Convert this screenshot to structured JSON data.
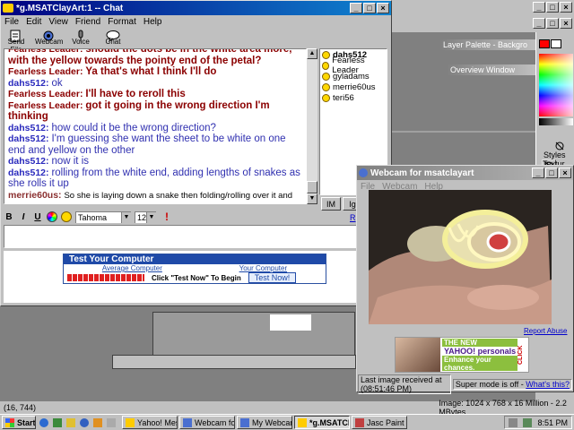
{
  "chat_window": {
    "title": "*g.MSATClayArt:1 -- Chat",
    "menu": [
      "File",
      "Edit",
      "View",
      "Friend",
      "Format",
      "Help"
    ],
    "toolbar": [
      {
        "label": "Send File",
        "icon": "send-file-icon"
      },
      {
        "label": "Webcam",
        "icon": "webcam-icon"
      },
      {
        "label": "Voice",
        "icon": "voice-icon"
      },
      {
        "label": "Chat",
        "icon": "chat-icon"
      }
    ],
    "messages": [
      {
        "sender": "Fearless Leader",
        "kind": "leader",
        "text": "should the dots be in the white area more, with the yellow towards the pointy end of the petal?"
      },
      {
        "sender": "Fearless Leader",
        "kind": "leader",
        "text": "Ya that's what I think I'll do"
      },
      {
        "sender": "dahs512",
        "kind": "dahs",
        "text": "ok"
      },
      {
        "sender": "Fearless Leader",
        "kind": "leader",
        "text": "I'll have to reroll this"
      },
      {
        "sender": "Fearless Leader",
        "kind": "leader",
        "text": "got it going in the wrong direction I'm thinking"
      },
      {
        "sender": "dahs512",
        "kind": "dahs",
        "text": "how could it be the wrong direction?"
      },
      {
        "sender": "dahs512",
        "kind": "dahs",
        "text": "I'm guessing she want the sheet to be white on one end and yellow on the other"
      },
      {
        "sender": "dahs512",
        "kind": "dahs",
        "text": "now it is"
      },
      {
        "sender": "dahs512",
        "kind": "dahs",
        "text": "rolling from the white end, adding lengths of snakes as she rolls it up"
      },
      {
        "sender": "merrie60us",
        "kind": "merrie",
        "text": "So she is laying down a snake then folding/rolling over it and then laying another snake....?"
      },
      {
        "sender": "dahs512",
        "kind": "dahs",
        "text": "yes"
      }
    ],
    "users": [
      {
        "name": "dahs512",
        "bold": true
      },
      {
        "name": "Fearless Leader",
        "bold": false
      },
      {
        "name": "gyladams",
        "bold": false
      },
      {
        "name": "merrie60us",
        "bold": false
      },
      {
        "name": "teri56",
        "bold": false
      }
    ],
    "im_button": "IM",
    "ignore_button": "Ig",
    "link_r": "R",
    "font_name": "Tahoma",
    "font_size": "12",
    "format_b": "B",
    "format_i": "I",
    "format_u": "U"
  },
  "ad_banner": {
    "title": "Test Your Computer",
    "average": "Average Computer",
    "yours": "Your Computer",
    "instruction": "Click \"Test Now\" To Begin",
    "button": "Test Now!"
  },
  "paint": {
    "layer_palette": "Layer Palette - Backgro",
    "overview": "Overview Window",
    "styles": "Styles",
    "textures": "Textur"
  },
  "webcam_window": {
    "title": "Webcam for msatclayart",
    "menu": [
      "File",
      "Webcam",
      "Help"
    ],
    "report": "Report Abuse",
    "status_left": "Last image received at (08:51:46 PM)",
    "status_right": "Super mode is off - ",
    "whats_this": "What's this?",
    "ad_line1": "THE NEW",
    "ad_brand": "YAHOO! personals",
    "ad_line3": "Enhance your chances.",
    "ad_click": "CLICK"
  },
  "status_bar": {
    "coords": "(16, 744)",
    "image_info": "Image:  1024 x 768 x 16 Million - 2.2 MBytes"
  },
  "taskbar": {
    "start": "Start",
    "items": [
      {
        "label": "Yahoo! Mess...",
        "active": false
      },
      {
        "label": "Webcam for ...",
        "active": false
      },
      {
        "label": "My Webcam (...",
        "active": false
      },
      {
        "label": "*g.MSATCl...",
        "active": true
      },
      {
        "label": "Jasc Paint Sh...",
        "active": false
      }
    ],
    "clock": "8:51 PM"
  },
  "colors": {
    "title_active": "#000080",
    "leader_name": "#8b0000",
    "dahs_name": "#2b2bbd"
  }
}
